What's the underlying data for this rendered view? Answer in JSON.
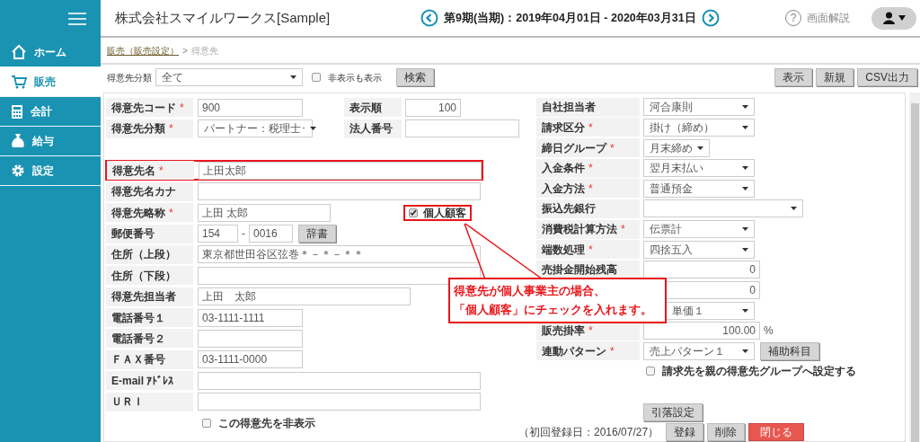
{
  "header": {
    "company": "株式会社スマイルワークス[Sample]",
    "period": "第9期(当期)：2019年04月01日 - 2020年03月31日",
    "help_icon": "?",
    "help": "画面解説"
  },
  "sidebar": {
    "items": [
      {
        "label": "ホーム",
        "selected": false
      },
      {
        "label": "販売",
        "selected": true
      },
      {
        "label": "会計",
        "selected": false
      },
      {
        "label": "給与",
        "selected": false
      },
      {
        "label": "設定",
        "selected": false
      }
    ]
  },
  "breadcrumb": {
    "link": "販売（販売設定）",
    "separator": ">",
    "current": "得意先"
  },
  "filter": {
    "label": "得意先分類",
    "value": "全て",
    "show_hidden": {
      "label": "非表示も表示",
      "checked": false
    },
    "search": "検索"
  },
  "actions": [
    "表示",
    "新規",
    "CSV出力"
  ],
  "left_fields": [
    {
      "kind": "text",
      "label": "得意先コード",
      "required_mark": "*",
      "value": "900",
      "extra": {
        "label": "表示順",
        "value": "100"
      }
    },
    {
      "kind": "select",
      "label": "得意先分類",
      "required_mark": "*",
      "value": "パートナー：税理士･",
      "extra": {
        "label": "法人番号"
      }
    },
    {
      "kind": "spacer"
    },
    {
      "kind": "text",
      "label": "得意先名",
      "required_mark": "*",
      "value": "上田太郎",
      "highlighted": true
    },
    {
      "kind": "text",
      "label": "得意先名カナ"
    },
    {
      "kind": "text",
      "label": "得意先略称",
      "required_mark": "*",
      "value": "上田 太郎",
      "check": {
        "label": "個人顧客",
        "checked": true,
        "highlighted": true
      }
    },
    {
      "kind": "postal",
      "label": "郵便番号",
      "value": "154",
      "value2": "0016",
      "separator": "-",
      "button": "辞書"
    },
    {
      "kind": "text",
      "label": "住所（上段）",
      "value": "東京都世田谷区弦巻＊－＊－＊＊"
    },
    {
      "kind": "text",
      "label": "住所（下段）"
    },
    {
      "kind": "text",
      "label": "得意先担当者",
      "value": "上田　太郎"
    },
    {
      "kind": "text",
      "label": "電話番号１",
      "value": "03-1111-1111"
    },
    {
      "kind": "text",
      "label": "電話番号２"
    },
    {
      "kind": "text",
      "label": "ＦＡＸ番号",
      "value": "03-1111-0000"
    },
    {
      "kind": "text",
      "label": "E-mail ｱﾄﾞﾚｽ"
    },
    {
      "kind": "text",
      "label": "ＵＲＩ"
    },
    {
      "kind": "checkbox",
      "label": "この得意先を非表示",
      "checked": false
    }
  ],
  "right_fields": [
    {
      "kind": "select",
      "label": "自社担当者",
      "value": "河合康則"
    },
    {
      "kind": "select",
      "label": "請求区分",
      "required_mark": "*",
      "value": "掛け（締め）"
    },
    {
      "kind": "select",
      "label": "締日グループ",
      "required_mark": "*",
      "value": "月末締め"
    },
    {
      "kind": "select",
      "label": "入金条件",
      "required_mark": "*",
      "value": "翌月末払い"
    },
    {
      "kind": "select",
      "label": "入金方法",
      "required_mark": "*",
      "value": "普通預金"
    },
    {
      "kind": "select",
      "label": "振込先銀行"
    },
    {
      "kind": "select",
      "label": "消費税計算方法",
      "required_mark": "*",
      "value": "伝票計"
    },
    {
      "kind": "select",
      "label": "端数処理",
      "required_mark": "*",
      "value": "四捨五入"
    },
    {
      "kind": "number",
      "label": "売掛金開始残高",
      "value": "0"
    },
    {
      "kind": "number",
      "value": "0"
    },
    {
      "kind": "select",
      "value": "単価１"
    },
    {
      "kind": "number",
      "label": "販売掛率",
      "required_mark": "*",
      "value": "100.00",
      "suffix": "%"
    },
    {
      "kind": "select",
      "label": "連動パターン",
      "required_mark": "*",
      "value": "売上パターン１",
      "button": "補助科目"
    },
    {
      "kind": "checkbox",
      "label": "請求先を親の得意先グループへ設定する",
      "checked": false
    },
    {
      "kind": "spacer"
    },
    {
      "kind": "button",
      "label": "引落設定"
    }
  ],
  "footer": {
    "note": "（初回登録日：2016/07/27）",
    "buttons": [
      {
        "label": "登録",
        "kind": "normal"
      },
      {
        "label": "削除",
        "kind": "normal"
      },
      {
        "label": "閉じる",
        "kind": "danger"
      }
    ]
  },
  "callout": {
    "lines": [
      "得意先が個人事業主の場合、",
      "「個人顧客」にチェックを入れます。"
    ]
  }
}
